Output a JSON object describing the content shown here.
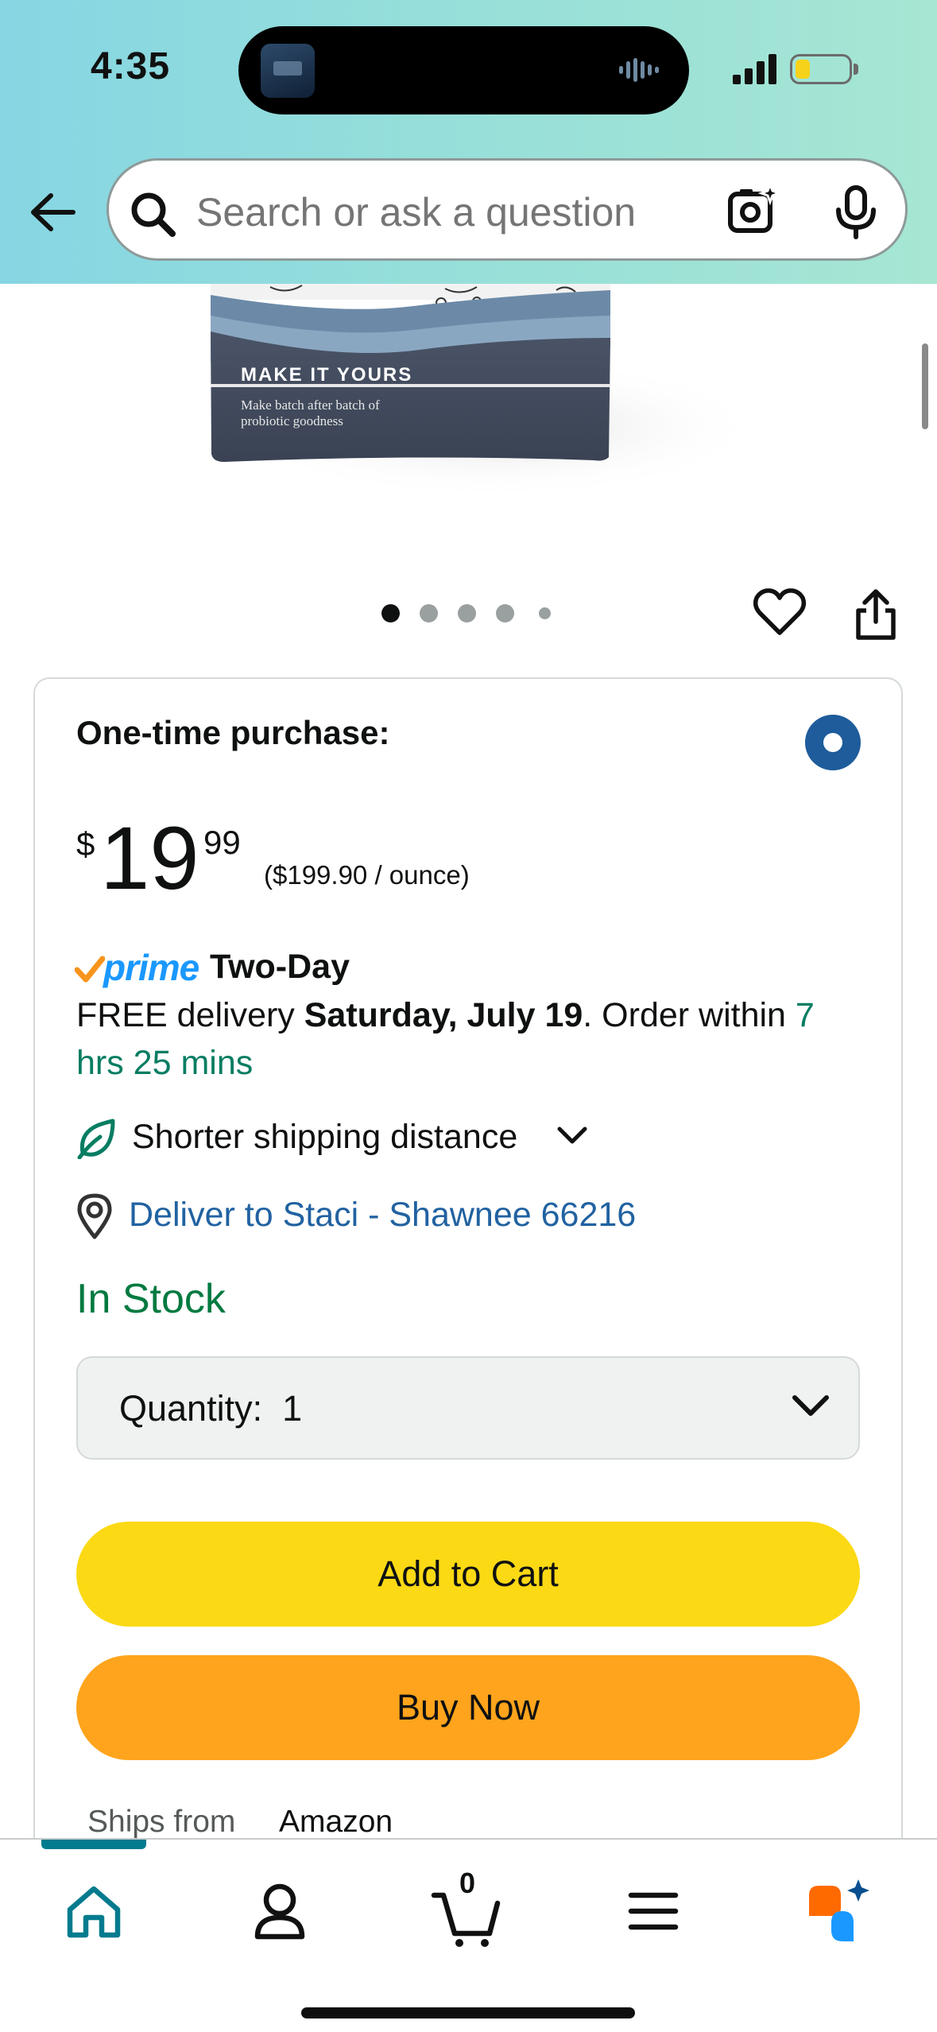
{
  "status_bar": {
    "time": "4:35"
  },
  "header": {
    "search_placeholder": "Search or ask a question"
  },
  "product_image": {
    "bag_heading": "MAKE IT YOURS",
    "bag_line1": "Make batch after batch of",
    "bag_line2": "probiotic goodness"
  },
  "carousel": {
    "total": 5,
    "active": 1
  },
  "purchase": {
    "option_label": "One-time purchase:",
    "price_symbol": "$",
    "price_whole": "19",
    "price_fraction": "99",
    "price_per_unit": "($199.90 / ounce)",
    "prime_label": "prime",
    "prime_speed": "Two-Day",
    "delivery_prefix": "FREE delivery ",
    "delivery_date": "Saturday, July 19",
    "delivery_mid": ". Order within ",
    "delivery_countdown": "7 hrs 25 mins",
    "shipping_note": "Shorter shipping distance",
    "deliver_to": "Deliver to Staci - Shawnee 66216",
    "stock_status": "In Stock",
    "quantity_label": "Quantity:",
    "quantity_value": "1",
    "add_to_cart": "Add to Cart",
    "buy_now": "Buy Now",
    "ships_from_label": "Ships from",
    "ships_from_value": "Amazon"
  },
  "bottom_nav": {
    "cart_count": "0",
    "active_tab": "home"
  },
  "colors": {
    "accent_teal": "#037b8e",
    "link_blue": "#2162a1",
    "stock_green": "#007a40",
    "add_to_cart_yellow": "#fbd914",
    "buy_now_orange": "#ffa41c",
    "prime_blue": "#1a98ff"
  }
}
